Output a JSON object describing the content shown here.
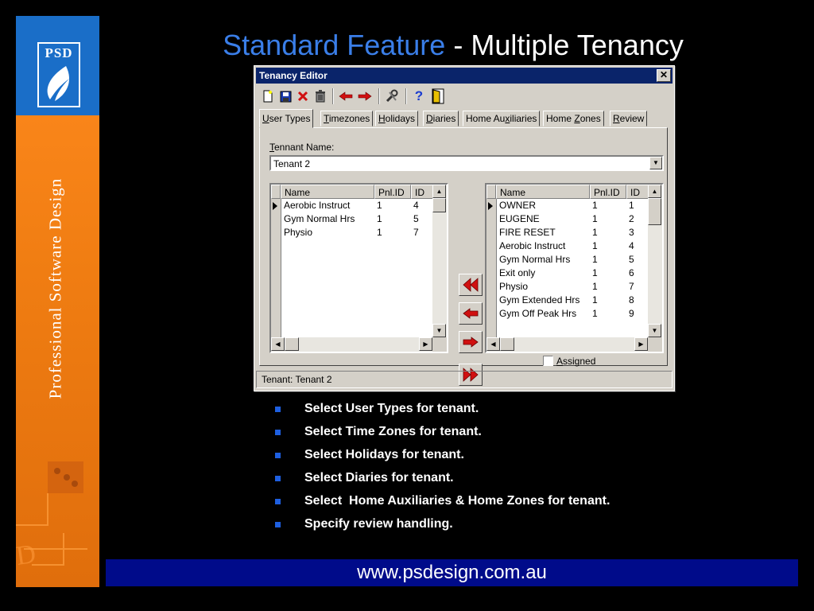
{
  "sidebar": {
    "logo_text": "PSD",
    "vertical_text": "Professional Software Design"
  },
  "slide": {
    "title_part1": "Standard Feature",
    "title_separator": "-",
    "title_part2": "Multiple Tenancy"
  },
  "window": {
    "title": "Tenancy Editor",
    "close_glyph": "✕",
    "toolbar": {
      "icons": [
        "new-icon",
        "save-icon",
        "delete-x-icon",
        "trash-icon",
        "previous-arrow-icon",
        "next-arrow-icon",
        "tools-icon",
        "help-icon",
        "exit-door-icon"
      ]
    },
    "tabs": [
      {
        "pre": "",
        "ul": "U",
        "post": "ser Types",
        "active": true
      },
      {
        "pre": "",
        "ul": "T",
        "post": "imezones",
        "active": false
      },
      {
        "pre": "",
        "ul": "H",
        "post": "olidays",
        "active": false
      },
      {
        "pre": "",
        "ul": "D",
        "post": "iaries",
        "active": false
      },
      {
        "pre": "Home Au",
        "ul": "x",
        "post": "iliaries",
        "active": false
      },
      {
        "pre": "Home ",
        "ul": "Z",
        "post": "ones",
        "active": false
      },
      {
        "pre": "",
        "ul": "R",
        "post": "eview",
        "active": false
      }
    ],
    "tenant_name_label_ul": "T",
    "tenant_name_label_rest": "ennant Name:",
    "tenant_name_value": "Tenant 2",
    "columns": {
      "name": "Name",
      "pnlid": "Pnl.ID",
      "id": "ID"
    },
    "assigned_rows": [
      {
        "name": "Aerobic Instruct",
        "pnlid": "1",
        "id": "4",
        "current": true
      },
      {
        "name": "Gym Normal Hrs",
        "pnlid": "1",
        "id": "5",
        "current": false
      },
      {
        "name": "Physio",
        "pnlid": "1",
        "id": "7",
        "current": false
      }
    ],
    "available_rows": [
      {
        "name": "OWNER",
        "pnlid": "1",
        "id": "1",
        "current": true
      },
      {
        "name": "EUGENE",
        "pnlid": "1",
        "id": "2",
        "current": false
      },
      {
        "name": "FIRE RESET",
        "pnlid": "1",
        "id": "3",
        "current": false
      },
      {
        "name": "Aerobic Instruct",
        "pnlid": "1",
        "id": "4",
        "current": false
      },
      {
        "name": "Gym Normal Hrs",
        "pnlid": "1",
        "id": "5",
        "current": false
      },
      {
        "name": "Exit only",
        "pnlid": "1",
        "id": "6",
        "current": false
      },
      {
        "name": "Physio",
        "pnlid": "1",
        "id": "7",
        "current": false
      },
      {
        "name": "Gym Extended Hrs",
        "pnlid": "1",
        "id": "8",
        "current": false
      },
      {
        "name": "Gym Off Peak Hrs",
        "pnlid": "1",
        "id": "9",
        "current": false
      }
    ],
    "assigned_checkbox": {
      "ul": "A",
      "rest": "ssigned",
      "checked": false
    },
    "status": "Tenant:  Tenant 2"
  },
  "bullets": [
    "Select User Types for tenant.",
    "Select Time Zones for tenant.",
    "Select Holidays for tenant.",
    "Select Diaries for tenant.",
    "Select  Home Auxiliaries & Home Zones for tenant.",
    "Specify review handling."
  ],
  "footer": {
    "url": "www.psdesign.com.au"
  },
  "colors": {
    "title_accent": "#3a7ee8",
    "sidebar_orange": "#f07d12",
    "logo_blue": "#1a6ec8",
    "footer_navy": "#000b8a",
    "titlebar_navy": "#0a246a",
    "bullet_blue": "#1e5fe0",
    "arrow_red": "#d01010"
  }
}
